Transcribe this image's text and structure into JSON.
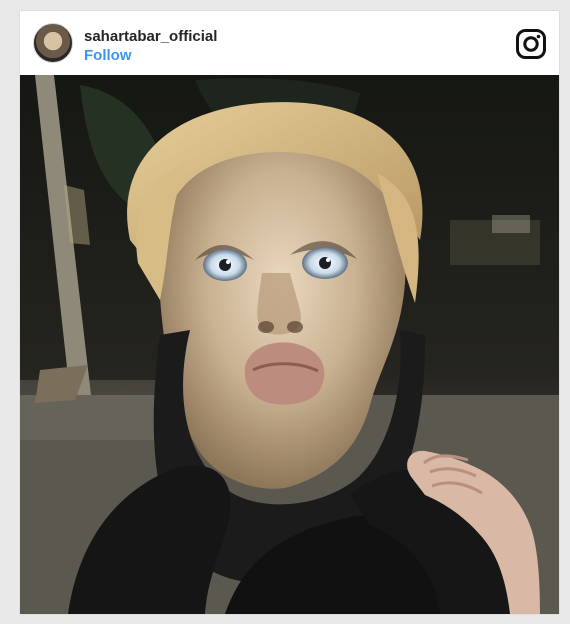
{
  "post": {
    "username": "sahartabar_official",
    "follow_label": "Follow"
  },
  "icons": {
    "brand": "instagram-icon",
    "avatar": "profile-avatar"
  },
  "colors": {
    "follow": "#3897f0",
    "username": "#262626",
    "card_bg": "#ffffff",
    "page_bg": "#e9e9e9"
  }
}
